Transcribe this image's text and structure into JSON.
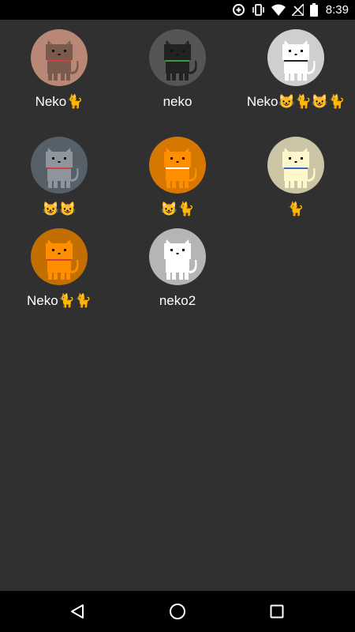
{
  "status_bar": {
    "time": "8:39",
    "icons": [
      "data-saver-icon",
      "vibrate-icon",
      "wifi-icon",
      "no-signal-icon",
      "battery-icon"
    ]
  },
  "cats": [
    {
      "name": "Neko🐈",
      "body_color": "#7a5a4c",
      "bg_color": "#b88775",
      "collar_color": "#d04040",
      "accent": "#ffffff"
    },
    {
      "name": "neko",
      "body_color": "#222222",
      "bg_color": "#555555",
      "collar_color": "#3aa13a",
      "accent": "#e58fb0"
    },
    {
      "name": "Neko😺🐈😺🐈",
      "body_color": "#ffffff",
      "bg_color": "#cfcfcf",
      "collar_color": "#222222",
      "accent": "#ffffff"
    },
    {
      "name": "😺😺",
      "body_color": "#8e959c",
      "bg_color": "#566068",
      "collar_color": "#d04040",
      "accent": "#ffffff"
    },
    {
      "name": "😺🐈",
      "body_color": "#ff8f00",
      "bg_color": "#d67800",
      "collar_color": "#ffffff",
      "accent": "#ffffff"
    },
    {
      "name": "🐈",
      "body_color": "#fff6cc",
      "bg_color": "#cbc5a5",
      "collar_color": "#3a6ad0",
      "accent": "#ffffff"
    },
    {
      "name": "Neko🐈🐈",
      "body_color": "#ff8f00",
      "bg_color": "#c26e00",
      "collar_color": "#d04040",
      "accent": "#e58fb0"
    },
    {
      "name": "neko2",
      "body_color": "#ffffff",
      "bg_color": "#b5b5b5",
      "collar_color": "#ffffff",
      "accent": "#ffffff"
    }
  ],
  "nav_bar": {
    "icons": [
      "back-icon",
      "home-icon",
      "recents-icon"
    ]
  }
}
